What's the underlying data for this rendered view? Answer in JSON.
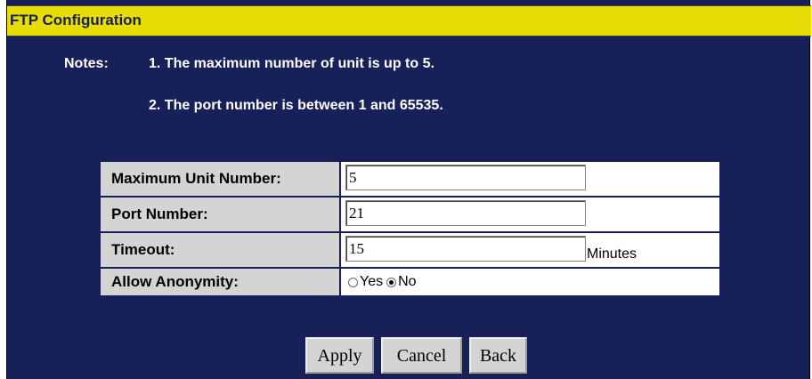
{
  "title": "FTP Configuration",
  "notes": {
    "label": "Notes:",
    "items": [
      "1. The maximum number of unit is up to 5.",
      "2. The port number is between 1 and 65535."
    ]
  },
  "fields": {
    "max_unit": {
      "label": "Maximum Unit Number:",
      "value": "5"
    },
    "port": {
      "label": "Port Number:",
      "value": "21"
    },
    "timeout": {
      "label": "Timeout:",
      "value": "15",
      "unit": "Minutes"
    },
    "anonymity": {
      "label": "Allow Anonymity:",
      "options": [
        "Yes",
        "No"
      ],
      "selected": "No"
    }
  },
  "buttons": {
    "apply": "Apply",
    "cancel": "Cancel",
    "back": "Back"
  },
  "colors": {
    "background": "#172058",
    "title_bar": "#e7dc05",
    "label_cell": "#d4d4d4"
  }
}
